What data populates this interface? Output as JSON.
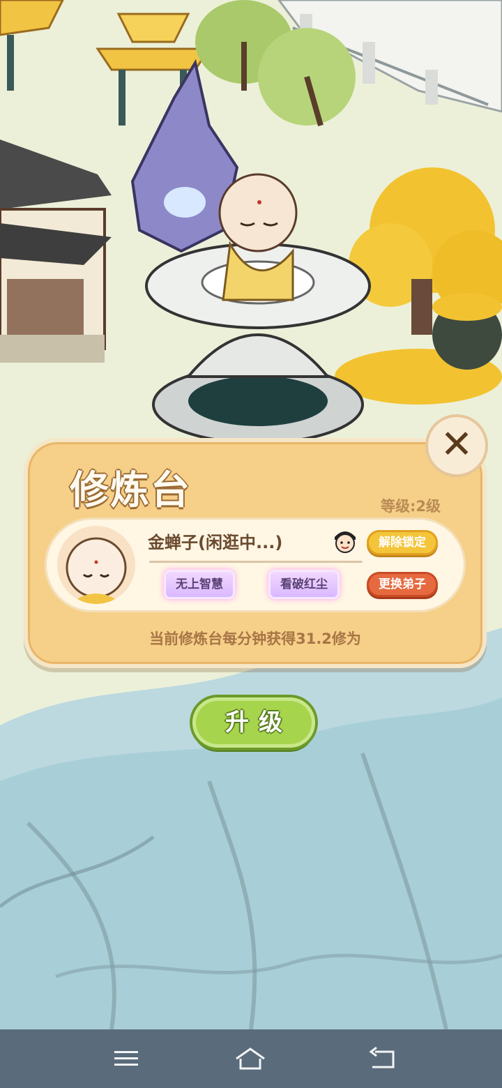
{
  "panel": {
    "title": "修炼台",
    "level": "等级:2级",
    "disciple": {
      "name": "金蝉子(闲逛中...)",
      "traits": [
        "无上智慧",
        "看破红尘"
      ]
    },
    "buttons": {
      "unlock": "解除锁定",
      "swap": "更换弟子"
    },
    "rate": "当前修炼台每分钟获得31.2修为",
    "close_symbol": "✕"
  },
  "upgrade_label": "升级",
  "icons": {
    "close": "close-icon",
    "face": "disciple-face-icon",
    "nav_menu": "menu-icon",
    "nav_home": "home-icon",
    "nav_back": "back-icon"
  },
  "colors": {
    "panel": "#f6cf88",
    "upgrade": "#a7d44d",
    "unlock": "#f4c53b",
    "swap": "#e6693f",
    "navbar": "#5a6b7b"
  }
}
